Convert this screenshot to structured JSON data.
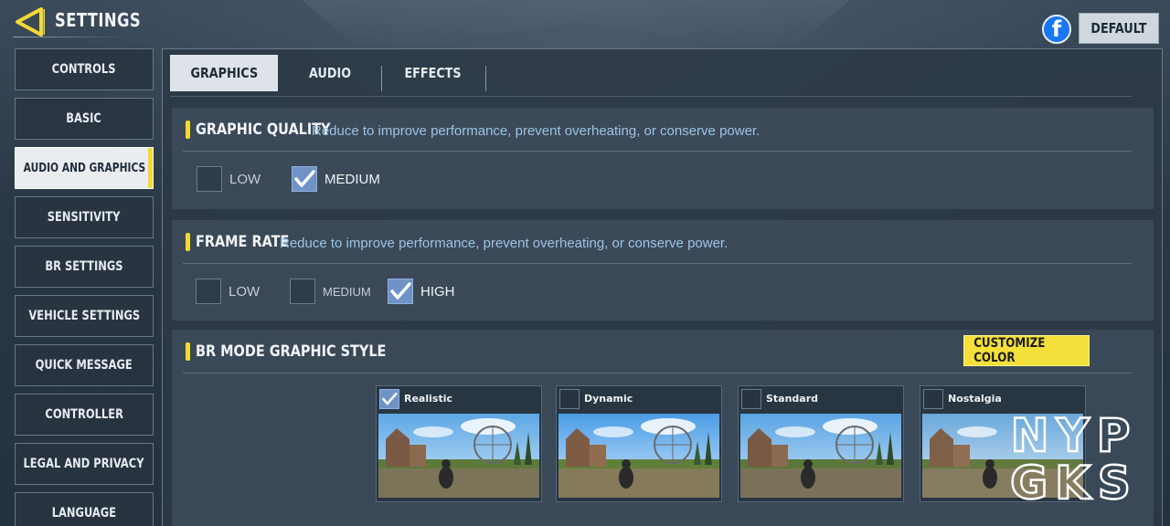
{
  "header": {
    "title": "SETTINGS",
    "default_label": "DEFAULT",
    "facebook_glyph": "f"
  },
  "sidebar": {
    "items": [
      {
        "label": "CONTROLS",
        "active": false
      },
      {
        "label": "BASIC",
        "active": false
      },
      {
        "label": "AUDIO AND GRAPHICS",
        "active": true
      },
      {
        "label": "SENSITIVITY",
        "active": false
      },
      {
        "label": "BR SETTINGS",
        "active": false
      },
      {
        "label": "VEHICLE SETTINGS",
        "active": false
      },
      {
        "label": "QUICK MESSAGE",
        "active": false
      },
      {
        "label": "CONTROLLER",
        "active": false
      },
      {
        "label": "LEGAL AND PRIVACY",
        "active": false
      },
      {
        "label": "LANGUAGE",
        "active": false
      }
    ]
  },
  "tabs": [
    {
      "label": "GRAPHICS",
      "active": true
    },
    {
      "label": "AUDIO",
      "active": false
    },
    {
      "label": "EFFECTS",
      "active": false
    }
  ],
  "graphic_quality": {
    "title": "GRAPHIC QUALITY",
    "description": "Reduce to improve performance, prevent overheating, or conserve power.",
    "options": [
      {
        "label": "LOW",
        "checked": false
      },
      {
        "label": "MEDIUM",
        "checked": true
      }
    ]
  },
  "frame_rate": {
    "title": "FRAME RATE",
    "description": "Reduce to improve performance, prevent overheating, or conserve power.",
    "options": [
      {
        "label": "LOW",
        "checked": false
      },
      {
        "label": "MEDIUM",
        "checked": false
      },
      {
        "label": "HIGH",
        "checked": true
      }
    ]
  },
  "br_mode": {
    "title": "BR MODE GRAPHIC STYLE",
    "customize_label": "CUSTOMIZE COLOR",
    "styles": [
      {
        "label": "Realistic",
        "checked": true
      },
      {
        "label": "Dynamic",
        "checked": false
      },
      {
        "label": "Standard",
        "checked": false
      },
      {
        "label": "Nostalgia",
        "checked": false
      }
    ]
  },
  "watermark": {
    "line1": "NYP",
    "line2": "GKS"
  },
  "colors": {
    "accent_yellow": "#f2d935",
    "checkbox_checked": "#6f93c6",
    "description_text": "#9cc4e4",
    "facebook_blue": "#1877f2"
  }
}
